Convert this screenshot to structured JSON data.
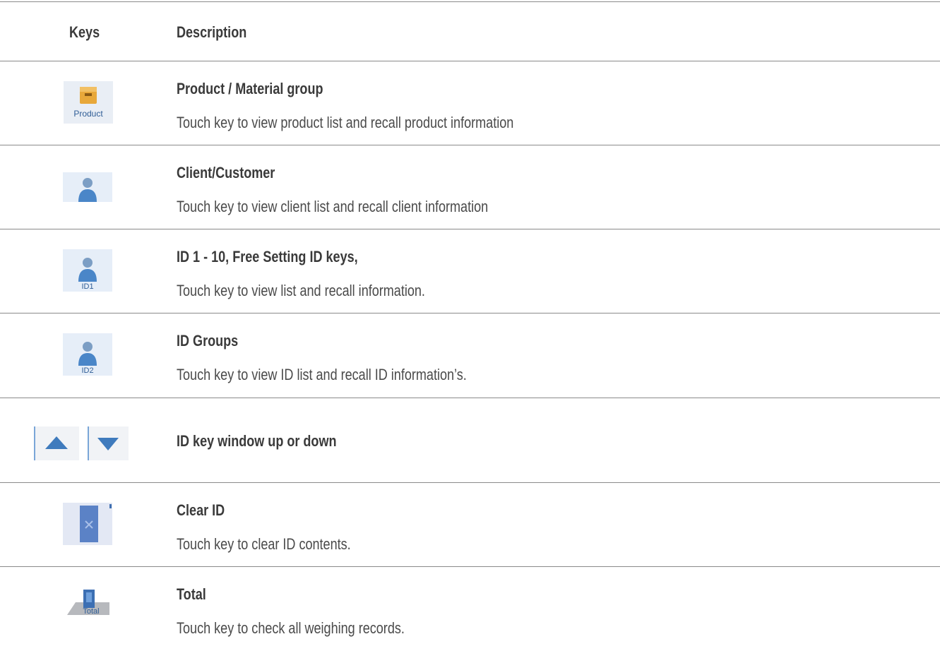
{
  "header": {
    "keys_label": "Keys",
    "description_label": "Description"
  },
  "rows": [
    {
      "icon": "product-box-icon",
      "icon_text": "Product",
      "title": "Product / Material group",
      "description": "Touch key to view product list and recall product information"
    },
    {
      "icon": "client-person-icon",
      "title": "Client/Customer",
      "description": "Touch key to view client list and recall client information"
    },
    {
      "icon": "id-person-icon",
      "icon_text": "ID1",
      "title": "ID 1 - 10, Free Setting ID keys,",
      "description": "Touch key to view list and recall information."
    },
    {
      "icon": "id-group-person-icon",
      "icon_text": "ID2",
      "title": "ID  Groups",
      "description": "Touch key to view ID list and recall ID information’s."
    },
    {
      "icon": "arrow-up-down-icon",
      "title": "ID key window up or down",
      "description": ""
    },
    {
      "icon": "clear-x-icon",
      "title": "Clear ID",
      "description": "Touch key to clear ID contents."
    },
    {
      "icon": "total-icon",
      "icon_text": "Total",
      "title": "Total",
      "description": "Touch key to check all weighing records."
    }
  ],
  "colors": {
    "rule": "#8a8a8a",
    "icon_blue": "#4a86c8",
    "icon_bg": "#e6eef8"
  }
}
